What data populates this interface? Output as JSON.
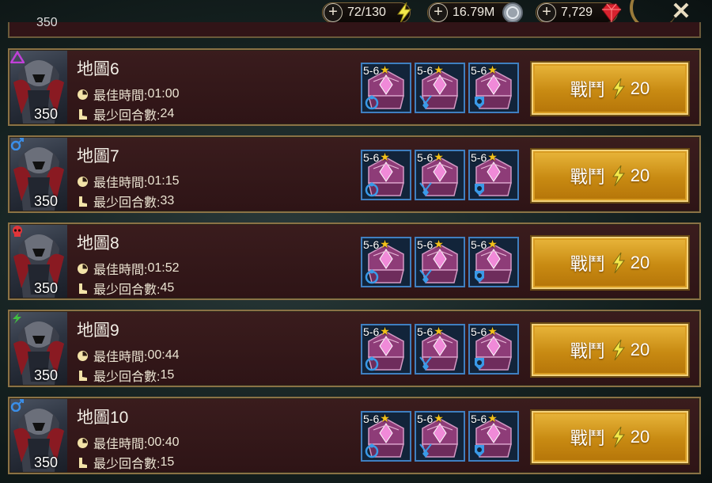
{
  "resources": {
    "energy": "72/130",
    "silver": "16.79M",
    "gems": "7,729",
    "plus_glyph": "+",
    "close_glyph": "✕"
  },
  "partial_row": {
    "level": "350"
  },
  "rows": [
    {
      "title": "地圖6",
      "best_time_label": "最佳時間:",
      "best_time": "01:00",
      "min_turns_label": "最少回合數:",
      "min_turns": "24",
      "level": "350",
      "affinity": "magic",
      "affinity_color": "#c040d8",
      "rewards": [
        "5-6",
        "5-6",
        "5-6"
      ],
      "fight_label": "戰鬥",
      "fight_cost": "20"
    },
    {
      "title": "地圖7",
      "best_time_label": "最佳時間:",
      "best_time": "01:15",
      "min_turns_label": "最少回合數:",
      "min_turns": "33",
      "level": "350",
      "affinity": "spirit",
      "affinity_color": "#3a8ee8",
      "rewards": [
        "5-6",
        "5-6",
        "5-6"
      ],
      "fight_label": "戰鬥",
      "fight_cost": "20"
    },
    {
      "title": "地圖8",
      "best_time_label": "最佳時間:",
      "best_time": "01:52",
      "min_turns_label": "最少回合數:",
      "min_turns": "45",
      "level": "350",
      "affinity": "force",
      "affinity_color": "#e0353a",
      "rewards": [
        "5-6",
        "5-6",
        "5-6"
      ],
      "fight_label": "戰鬥",
      "fight_cost": "20"
    },
    {
      "title": "地圖9",
      "best_time_label": "最佳時間:",
      "best_time": "00:44",
      "min_turns_label": "最少回合數:",
      "min_turns": "15",
      "level": "350",
      "affinity": "void",
      "affinity_color": "#40c040",
      "rewards": [
        "5-6",
        "5-6",
        "5-6"
      ],
      "fight_label": "戰鬥",
      "fight_cost": "20"
    },
    {
      "title": "地圖10",
      "best_time_label": "最佳時間:",
      "best_time": "00:40",
      "min_turns_label": "最少回合數:",
      "min_turns": "15",
      "level": "350",
      "affinity": "spirit",
      "affinity_color": "#3a8ee8",
      "rewards": [
        "5-6",
        "5-6",
        "5-6"
      ],
      "fight_label": "戰鬥",
      "fight_cost": "20"
    }
  ],
  "icons": {
    "energy": "lightning-icon",
    "silver": "silver-coin-icon",
    "gems": "ruby-gem-icon",
    "time": "clock-icon",
    "turns": "boot-icon",
    "reward_slots": [
      "ring-icon",
      "amulet-icon",
      "banner-icon"
    ]
  },
  "colors": {
    "energy_bolt": "#f3e84a",
    "fight_bg": "#d99a1c",
    "row_bg": "#341718",
    "row_border": "#8a7245",
    "star": "#f2c21a",
    "chest": "#8e3c78"
  }
}
